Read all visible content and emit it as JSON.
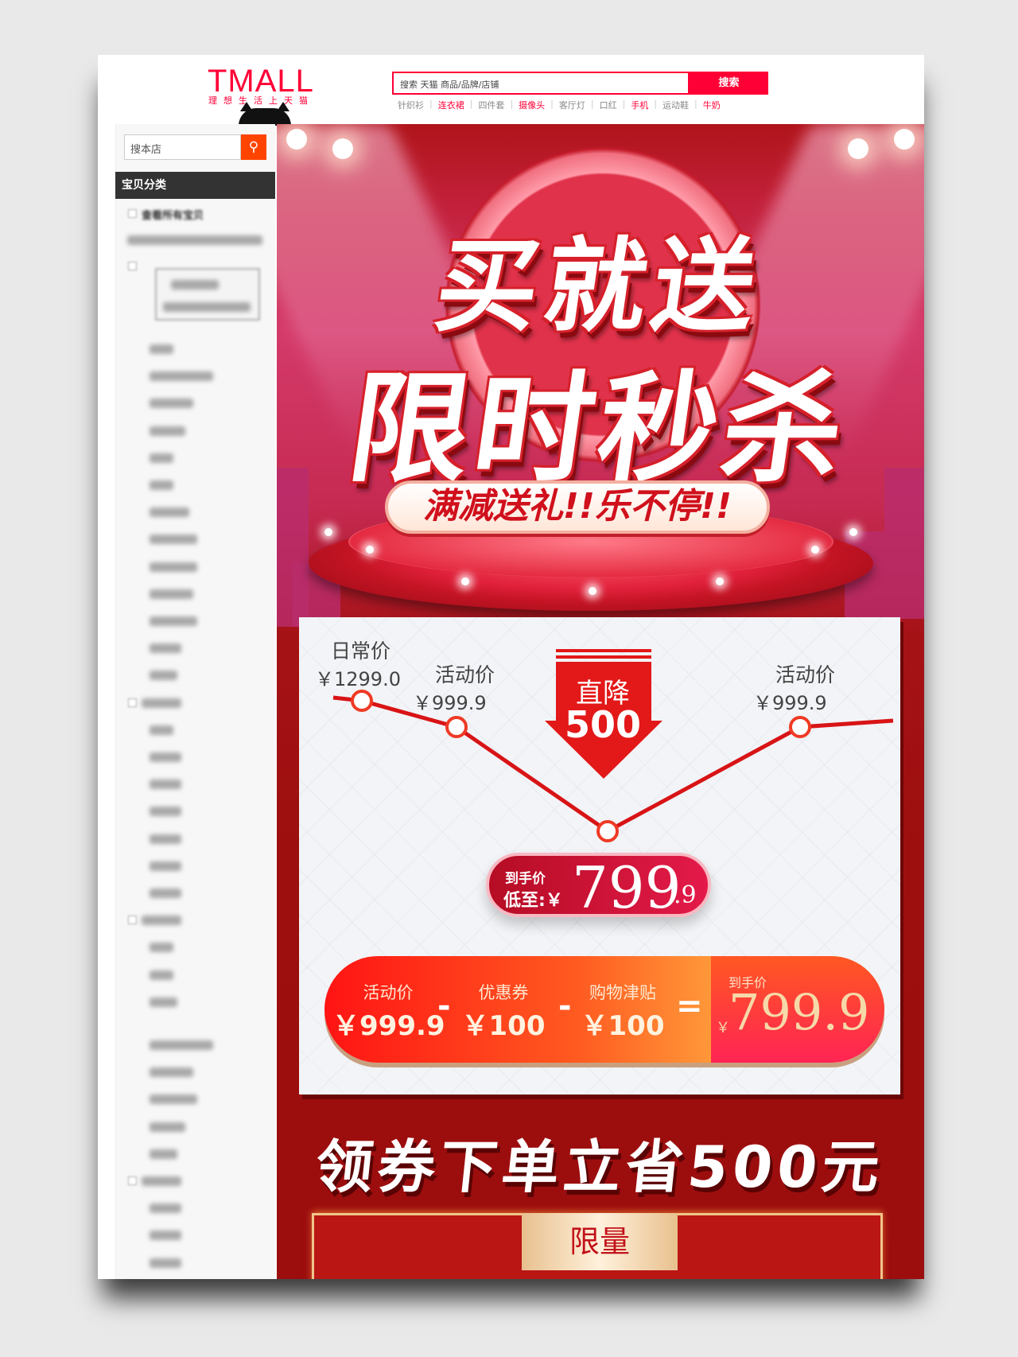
{
  "header": {
    "logo": "TMALL",
    "slogan": "理想生活上天猫",
    "search_placeholder": "搜索 天猫 商品/品牌/店铺",
    "search_button": "搜索",
    "hot_links": [
      {
        "label": "针织衫",
        "highlight": false
      },
      {
        "label": "连衣裙",
        "highlight": true
      },
      {
        "label": "四件套",
        "highlight": false
      },
      {
        "label": "摄像头",
        "highlight": true
      },
      {
        "label": "客厅灯",
        "highlight": false
      },
      {
        "label": "口红",
        "highlight": false
      },
      {
        "label": "手机",
        "highlight": true
      },
      {
        "label": "运动鞋",
        "highlight": false
      },
      {
        "label": "牛奶",
        "highlight": true
      }
    ]
  },
  "sidebar": {
    "search_placeholder": "搜本店",
    "search_icon": "search-icon",
    "category_title": "宝贝分类",
    "all_items": "查看所有宝贝"
  },
  "banner": {
    "title_line1": "买就送",
    "title_line2": "限时秒杀",
    "subtitle": "满减送礼!!乐不停!!",
    "chart": {
      "points": [
        {
          "label": "日常价",
          "price": "￥1299.0",
          "value": 1299.0
        },
        {
          "label": "活动价",
          "price": "￥999.9",
          "value": 999.9
        },
        {
          "label": "",
          "price": "",
          "value": 799.9
        },
        {
          "label": "活动价",
          "price": "￥999.9",
          "value": 999.9
        }
      ],
      "drop_label": "直降",
      "drop_value": "500"
    },
    "final_pill": {
      "line1": "到手价",
      "line2": "低至:￥",
      "price_int": "799",
      "price_dec": ".9"
    },
    "formula": {
      "items": [
        {
          "label": "活动价",
          "value": "￥999.9"
        },
        {
          "label": "优惠券",
          "value": "￥100"
        },
        {
          "label": "购物津贴",
          "value": "￥100"
        }
      ],
      "minus": "-",
      "equals": "=",
      "result_label": "到手价",
      "result_currency": "￥",
      "result_value": "799.9"
    },
    "coupon_slogan": "领券下单立省500元",
    "limit_tag": "限量",
    "colors": {
      "primary_red": "#d6101c",
      "dark_red": "#9c0d0e",
      "tmall_red": "#ff0036"
    }
  }
}
